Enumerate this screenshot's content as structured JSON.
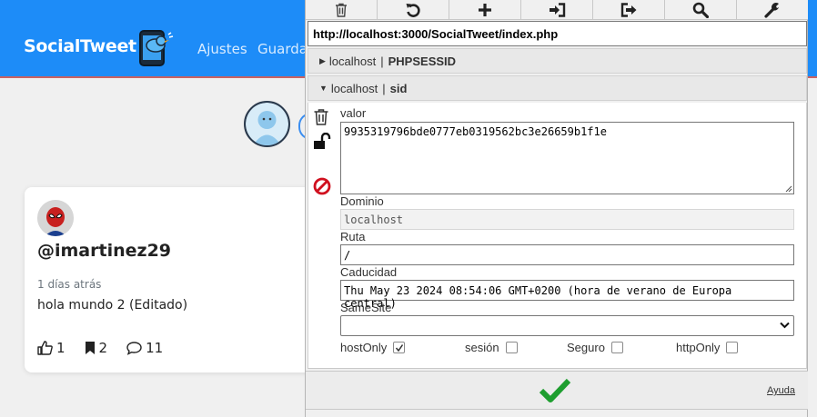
{
  "app": {
    "brand": "SocialTweet",
    "nav": {
      "ajustes": "Ajustes",
      "guarda": "Guarda"
    },
    "accent": "#1d8cf8"
  },
  "post": {
    "username": "@imartinez29",
    "time": "1 días atrás",
    "text": "hola mundo 2 (Editado)",
    "likes": "1",
    "saves": "2",
    "comments": "11"
  },
  "editor": {
    "toolbar": [
      "trash-icon",
      "undo-icon",
      "plus-icon",
      "import-icon",
      "export-icon",
      "search-icon",
      "wrench-icon"
    ],
    "url": "http://localhost:3000/SocialTweet/index.php",
    "cookies": [
      {
        "host": "localhost",
        "name": "PHPSESSID",
        "expanded": false
      },
      {
        "host": "localhost",
        "name": "sid",
        "expanded": true
      }
    ],
    "labels": {
      "valor": "valor",
      "dominio": "Dominio",
      "ruta": "Ruta",
      "caducidad": "Caducidad",
      "samesite": "SameSite",
      "hostonly": "hostOnly",
      "sesion": "sesión",
      "seguro": "Seguro",
      "httponly": "httpOnly"
    },
    "values": {
      "valor": "9935319796bde0777eb0319562bc3e26659b1f1e",
      "dominio": "localhost",
      "ruta": "/",
      "caducidad": "Thu May 23 2024 08:54:06 GMT+0200 (hora de verano de Europa central)",
      "samesite": ""
    },
    "checks": {
      "hostonly": true,
      "sesion": false,
      "seguro": false,
      "httponly": false
    },
    "help": "Ayuda",
    "confirm_color": "#1e9e2f"
  }
}
